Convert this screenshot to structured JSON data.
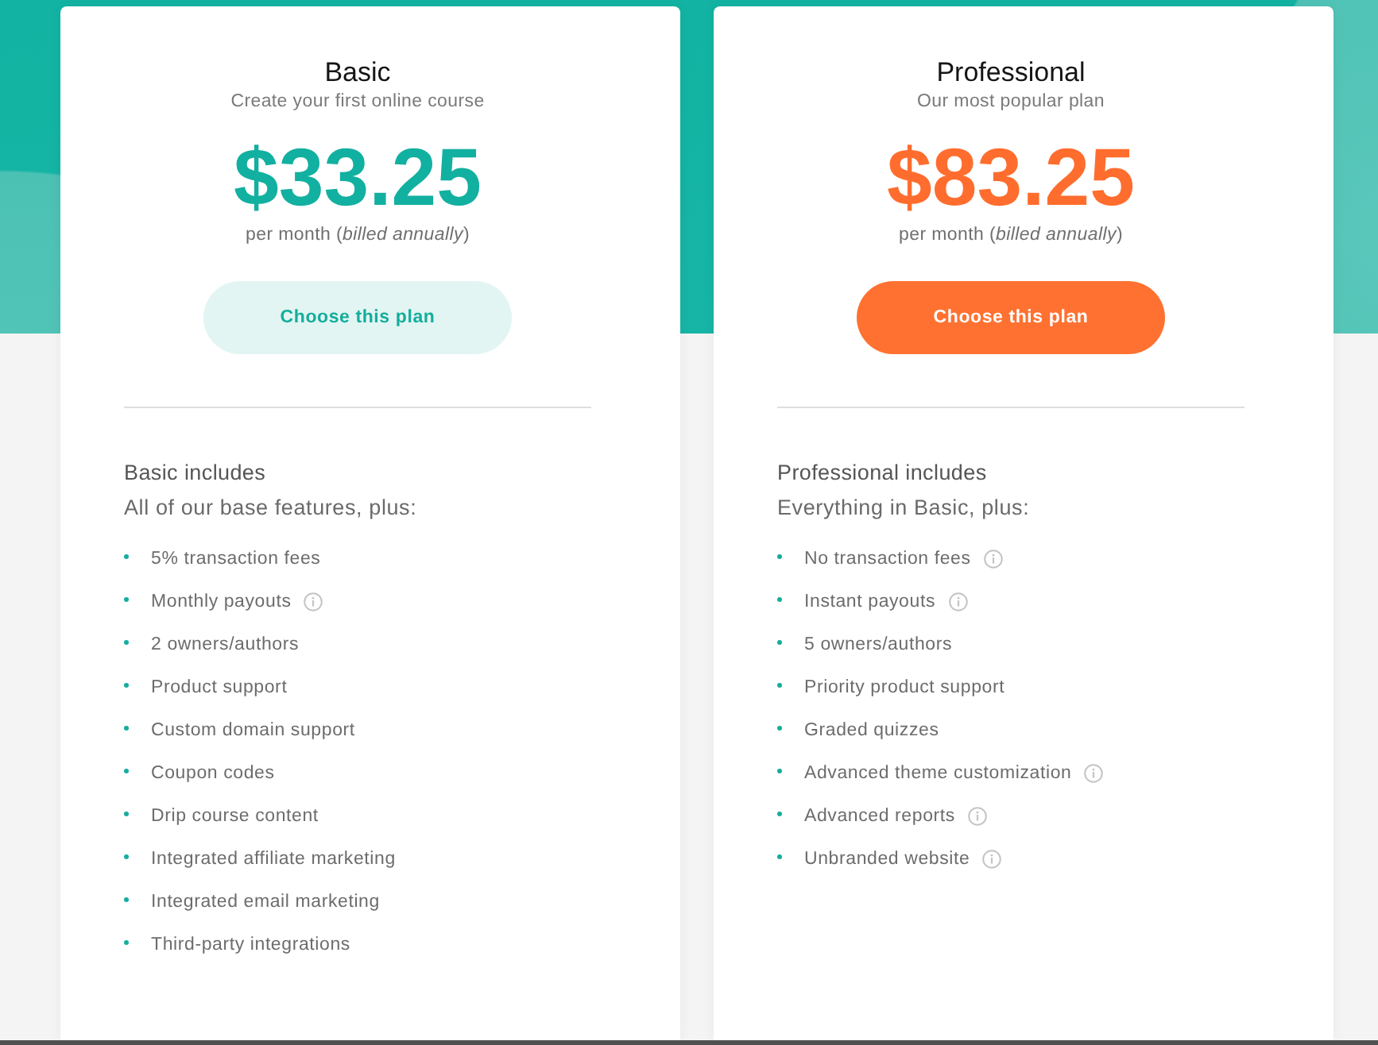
{
  "plans": [
    {
      "kind": "standard",
      "title": "Basic",
      "subtitle": "Create your first online course",
      "price": "$33.25",
      "billing": "per month (*billed annually*)",
      "button": "Choose this plan",
      "includes_heading": "Basic includes",
      "includes_intro": "All of our base features, plus:",
      "features": [
        {
          "text": "5% transaction fees",
          "info": false
        },
        {
          "text": "Monthly payouts",
          "info": true
        },
        {
          "text": "2 owners/authors",
          "info": false
        },
        {
          "text": "Product support",
          "info": false
        },
        {
          "text": "Custom domain support",
          "info": false
        },
        {
          "text": "Coupon codes",
          "info": false
        },
        {
          "text": "Drip course content",
          "info": false
        },
        {
          "text": "Integrated affiliate marketing",
          "info": false
        },
        {
          "text": "Integrated email marketing",
          "info": false
        },
        {
          "text": "Third-party integrations",
          "info": false
        }
      ]
    },
    {
      "kind": "featured",
      "title": "Professional",
      "subtitle": "Our most popular plan",
      "price": "$83.25",
      "billing": "per month (*billed annually*)",
      "button": "Choose this plan",
      "includes_heading": "Professional includes",
      "includes_intro": "Everything in Basic, plus:",
      "features": [
        {
          "text": "No transaction fees",
          "info": true
        },
        {
          "text": "Instant payouts",
          "info": true
        },
        {
          "text": "5 owners/authors",
          "info": false
        },
        {
          "text": "Priority product support",
          "info": false
        },
        {
          "text": "Graded quizzes",
          "info": false
        },
        {
          "text": "Advanced theme customization",
          "info": true
        },
        {
          "text": "Advanced reports",
          "info": true
        },
        {
          "text": "Unbranded website",
          "info": true
        }
      ]
    }
  ]
}
